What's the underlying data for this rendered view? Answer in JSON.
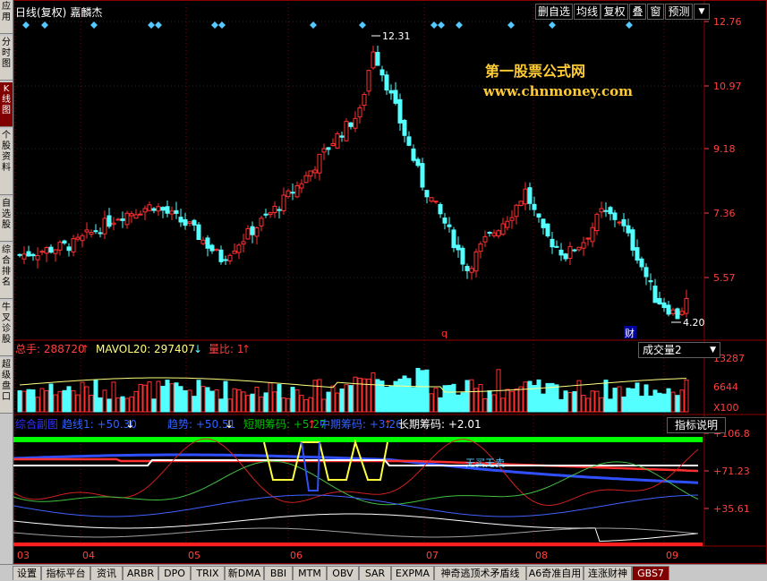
{
  "sidebar": {
    "items": [
      {
        "label": "应用",
        "active": false
      },
      {
        "label": "分时图",
        "active": false
      },
      {
        "label": "K线图",
        "active": true
      },
      {
        "label": "个股资料",
        "active": false
      },
      {
        "label": "自选股",
        "active": false
      },
      {
        "label": "综合排名",
        "active": false
      },
      {
        "label": "牛叉诊股",
        "active": false
      },
      {
        "label": "超级盘口",
        "active": false
      }
    ]
  },
  "header": {
    "title": "日线(复权)",
    "stock_name": "嘉麟杰",
    "buttons": [
      "删自选",
      "均线",
      "复权",
      "叠",
      "窗",
      "预测"
    ],
    "menu_icon": "dropdown-arrow-icon"
  },
  "watermark": {
    "line1": "第一股票公式网",
    "line2": "www.chnmoney.com"
  },
  "price_panel": {
    "y_ticks": [
      "12.76",
      "10.97",
      "9.18",
      "7.36",
      "5.57"
    ],
    "high_label": "12.31",
    "low_label": "4.20",
    "marker_q": "q",
    "marker_cai": "财"
  },
  "volume_panel": {
    "legend": [
      {
        "text": "总手: 288720",
        "arrow": "↑",
        "color": "#ff4040"
      },
      {
        "text": "MAVOL20: 297407",
        "arrow": "↓",
        "color": "#ffff80"
      },
      {
        "text": "量比: 1",
        "arrow": "↑",
        "color": "#ff4040"
      }
    ],
    "indicator_select": "成交量2",
    "y_ticks": [
      "13287",
      "6644",
      "X100"
    ]
  },
  "indicator_panel": {
    "legend": [
      {
        "text": "综合副图",
        "color": "#3030ff"
      },
      {
        "text": "趋线1: +50.30",
        "arrow": "↓",
        "color": "#3060ff"
      },
      {
        "text": "趋势: +50.51",
        "arrow": "↓",
        "color": "#3060ff"
      },
      {
        "text": "短期筹码: +5.27",
        "arrow": "↑",
        "color": "#00c000"
      },
      {
        "text": "中期筹码: +3.26",
        "arrow": "↑",
        "color": "#3060ff"
      },
      {
        "text": "长期筹码: +2.01",
        "color": "#ffffff"
      }
    ],
    "help_button": "指标说明",
    "y_ticks": [
      "+106.8",
      "+71.23",
      "+35.61"
    ],
    "annotation": "无买无卖"
  },
  "x_axis": {
    "labels": [
      "03",
      "04",
      "05",
      "06",
      "07",
      "08",
      "09"
    ]
  },
  "bottom_tabs": [
    {
      "label": "设置",
      "active": false
    },
    {
      "label": "指标平台",
      "active": false
    },
    {
      "label": "资讯",
      "active": false
    },
    {
      "label": "ARBR",
      "active": false
    },
    {
      "label": "DPO",
      "active": false
    },
    {
      "label": "TRIX",
      "active": false
    },
    {
      "label": "新DMA",
      "active": false
    },
    {
      "label": "BBI",
      "active": false
    },
    {
      "label": "MTM",
      "active": false
    },
    {
      "label": "OBV",
      "active": false
    },
    {
      "label": "SAR",
      "active": false
    },
    {
      "label": "EXPMA",
      "active": false
    },
    {
      "label": "神奇逃顶术矛盾线",
      "active": false
    },
    {
      "label": "A6奇准自用",
      "active": false
    },
    {
      "label": "连涨财神",
      "active": false
    },
    {
      "label": "GBS7",
      "active": true
    }
  ],
  "colors": {
    "up": "#ff3030",
    "down": "#54ffff",
    "grid": "#8b0000",
    "axis_text": "#ff4040",
    "green_band": "#00ff00"
  }
}
